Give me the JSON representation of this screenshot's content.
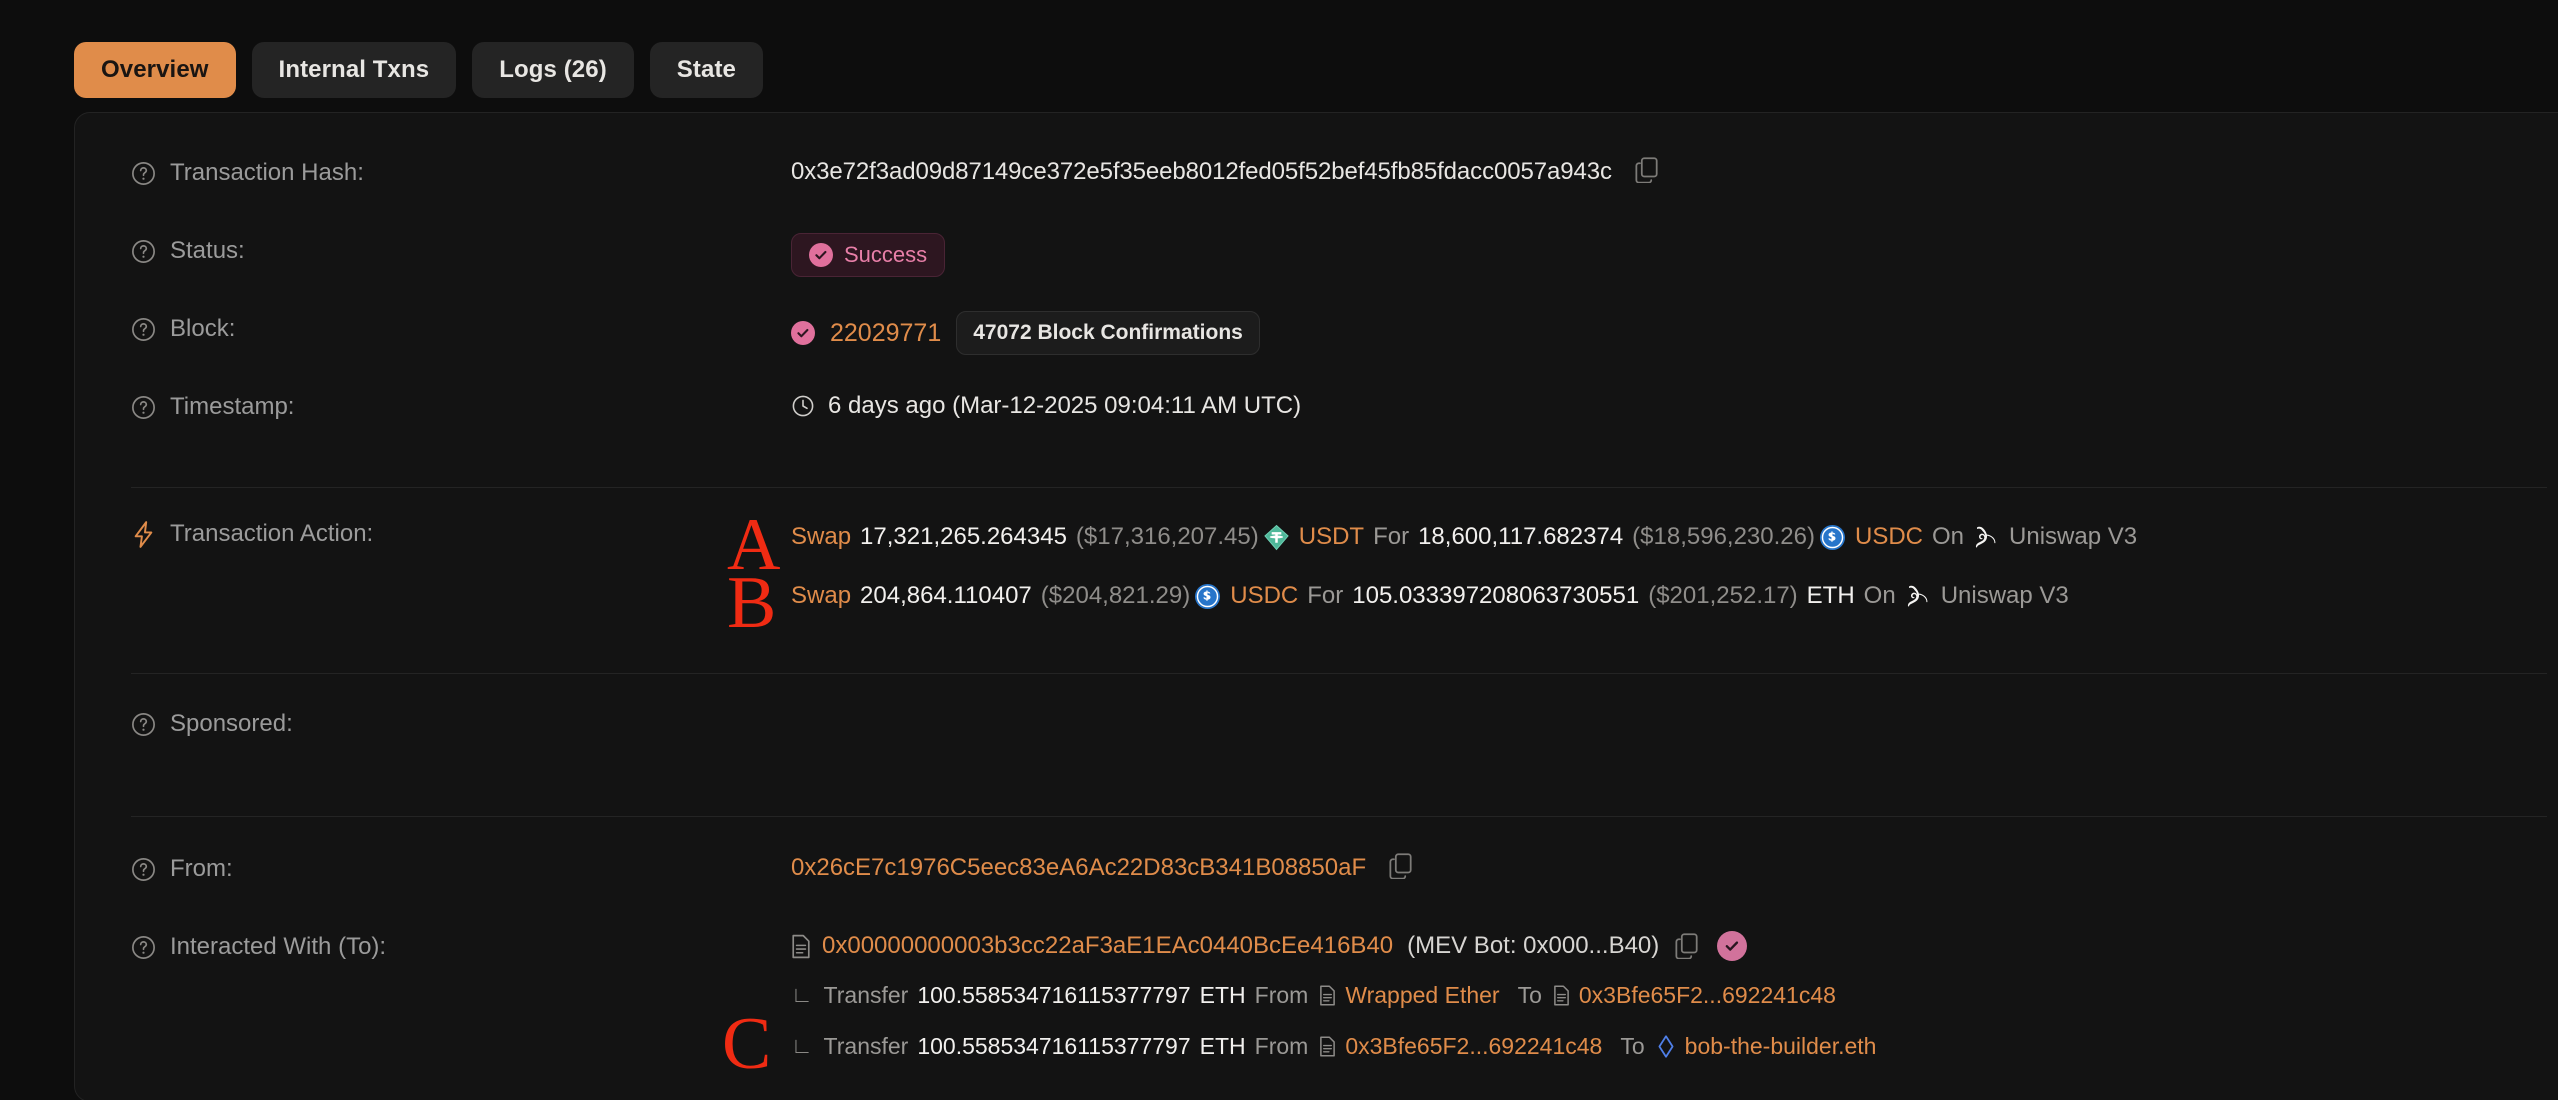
{
  "tabs": [
    {
      "label": "Overview",
      "active": true
    },
    {
      "label": "Internal Txns",
      "active": false
    },
    {
      "label": "Logs (26)",
      "active": false
    },
    {
      "label": "State",
      "active": false
    }
  ],
  "labels": {
    "transaction_hash": "Transaction Hash:",
    "status": "Status:",
    "block": "Block:",
    "timestamp": "Timestamp:",
    "transaction_action": "Transaction Action:",
    "sponsored": "Sponsored:",
    "from": "From:",
    "interacted_with": "Interacted With (To):"
  },
  "transaction": {
    "hash": "0x3e72f3ad09d87149ce372e5f35eeb8012fed05f52bef45fb85fdacc0057a943c",
    "status": "Success",
    "block_number": "22029771",
    "block_confirmations": "47072 Block Confirmations",
    "timestamp": "6 days ago (Mar-12-2025 09:04:11 AM UTC)",
    "from_address": "0x26cE7c1976C5eec83eA6Ac22D83cB341B08850aF",
    "to_address": "0x00000000003b3cc22aF3aE1EAc0440BcEe416B40",
    "to_tag": "(MEV Bot: 0x000...B40)"
  },
  "actions": [
    {
      "verb": "Swap",
      "amount_in": "17,321,265.264345",
      "value_in": "($17,316,207.45)",
      "token_in": "USDT",
      "token_in_icon": "tether-icon",
      "connector": "For",
      "amount_out": "18,600,117.682374",
      "value_out": "($18,596,230.26)",
      "token_out": "USDC",
      "token_out_icon": "usdc-icon",
      "on": "On",
      "platform": "Uniswap V3",
      "platform_icon": "unicorn-icon"
    },
    {
      "verb": "Swap",
      "amount_in": "204,864.110407",
      "value_in": "($204,821.29)",
      "token_in": "USDC",
      "token_in_icon": "usdc-icon",
      "connector": "For",
      "amount_out": "105.033397208063730551",
      "value_out": "($201,252.17)",
      "token_out": "ETH",
      "token_out_icon": "none",
      "on": "On",
      "platform": "Uniswap V3",
      "platform_icon": "unicorn-icon"
    }
  ],
  "transfers": [
    {
      "verb": "Transfer",
      "amount": "100.558534716115377797",
      "unit": "ETH",
      "from_label": "From",
      "from_name": "Wrapped Ether",
      "to_label": "To",
      "to_name": "0x3Bfe65F2...692241c48"
    },
    {
      "verb": "Transfer",
      "amount": "100.558534716115377797",
      "unit": "ETH",
      "from_label": "From",
      "from_name": "0x3Bfe65F2...692241c48",
      "to_label": "To",
      "to_name": "bob-the-builder.eth"
    }
  ],
  "annotations": [
    {
      "id": "A",
      "letter": "A"
    },
    {
      "id": "B",
      "letter": "B"
    },
    {
      "id": "C",
      "letter": "C"
    }
  ],
  "colors": {
    "accent": "#e08c4a",
    "background": "#0d0d0d",
    "card": "#131313",
    "status_pink": "#e0709c",
    "annotation_red": "#f02b13"
  }
}
